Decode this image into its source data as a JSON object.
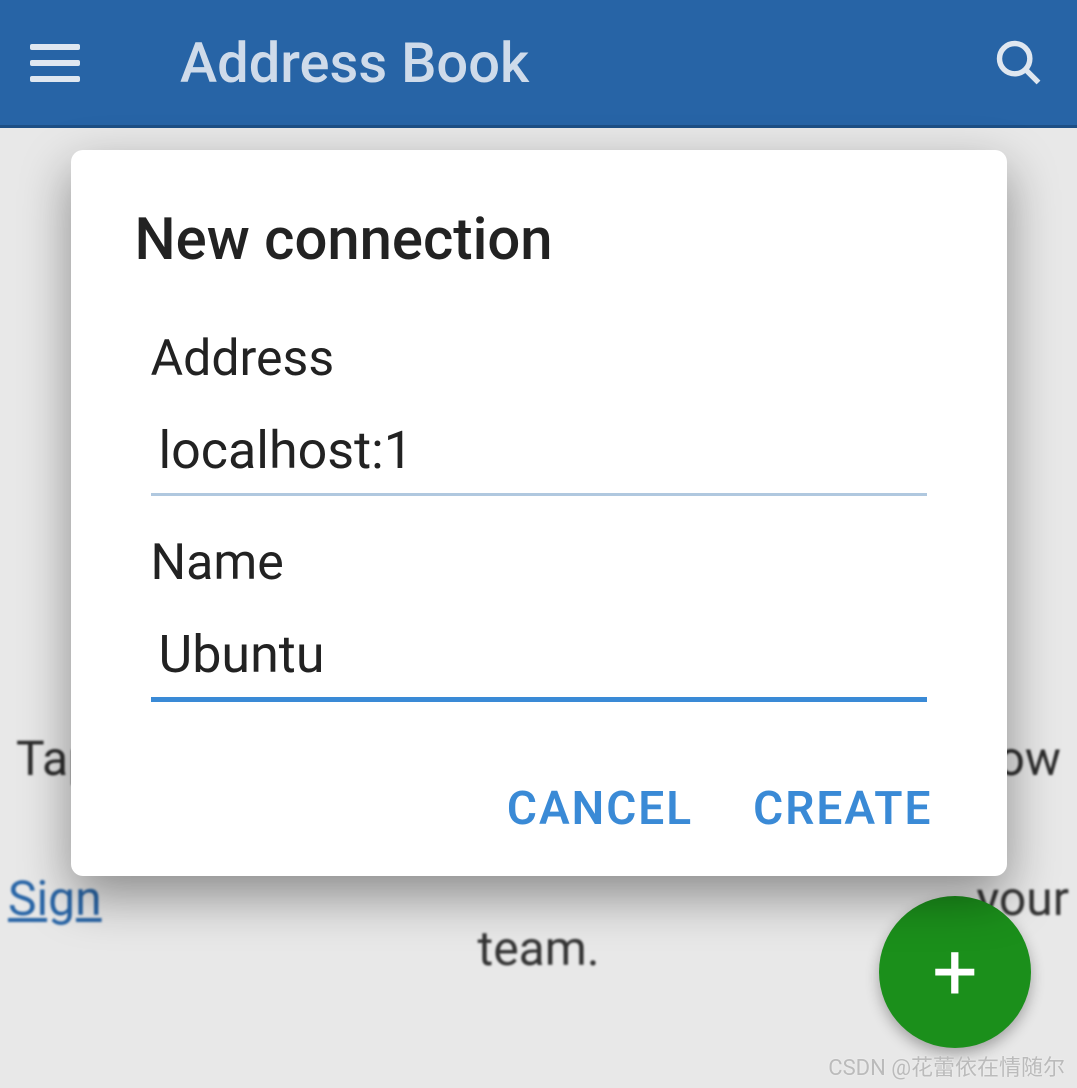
{
  "header": {
    "title": "Address Book"
  },
  "background": {
    "tap_text": "Tap",
    "ow_text": "ow",
    "signup_text": "Sign",
    "your_text": "your",
    "team_text": "team."
  },
  "dialog": {
    "title": "New connection",
    "fields": {
      "address": {
        "label": "Address",
        "value": "localhost:1"
      },
      "name": {
        "label": "Name",
        "value": "Ubuntu"
      }
    },
    "actions": {
      "cancel": "CANCEL",
      "create": "CREATE"
    }
  },
  "fab": {
    "glyph": "+"
  },
  "watermark": "CSDN @花蕾依在情随尔"
}
